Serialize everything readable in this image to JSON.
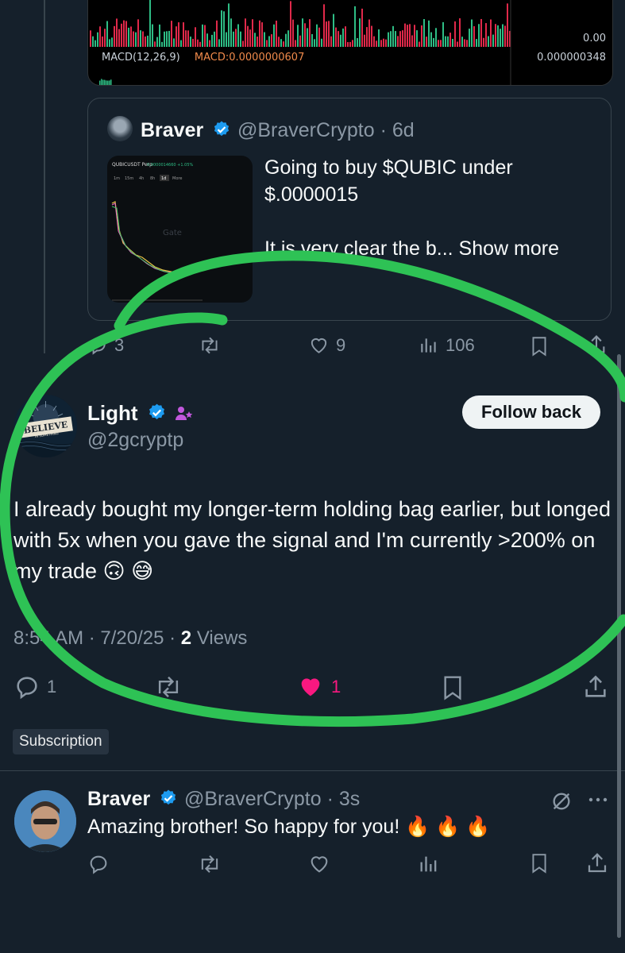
{
  "chart_card": {
    "macd_label": "MACD(12,26,9)",
    "macd_value": "MACD:0.0000000607",
    "zero_value": "0.00",
    "macd_right": "0.000000348"
  },
  "quote": {
    "name": "Braver",
    "handle": "@BraverCrypto",
    "time": "6d",
    "text": "Going to buy $QUBIC under $.0000015",
    "preview": "It is very clear the b...",
    "show_more": "Show more",
    "thumb": {
      "pair": "QUBICUSDT Perp",
      "price": "0.0000014660 +1.05%",
      "tabs": [
        "1m",
        "15m",
        "4h",
        "8h",
        "1d",
        "More"
      ],
      "watermark": "Gate"
    }
  },
  "quote_actions": {
    "replies": "3",
    "likes": "9",
    "views": "106"
  },
  "tweet": {
    "name": "Light",
    "handle": "@2gcryptp",
    "follow_label": "Follow back",
    "avatar_text_1": "BELIEVE",
    "avatar_text_2": "IN SOMETHING",
    "text": "I already bought my longer-term holding bag earlier, but longed with 5x when you gave the signal and I'm currently >200% on my trade 🙃 😅",
    "time": "8:54 AM",
    "date": "7/20/25",
    "views_count": "2",
    "views_label": "Views",
    "replies": "1",
    "likes": "1",
    "subscription_label": "Subscription"
  },
  "reply": {
    "name": "Braver",
    "handle": "@BraverCrypto",
    "time": "3s",
    "text": "Amazing brother! So happy for you! 🔥 🔥 🔥"
  },
  "colors": {
    "background": "#15202b",
    "like_active": "#f91880",
    "verified": "#1d9bf0",
    "annotation": "#2ec255"
  }
}
